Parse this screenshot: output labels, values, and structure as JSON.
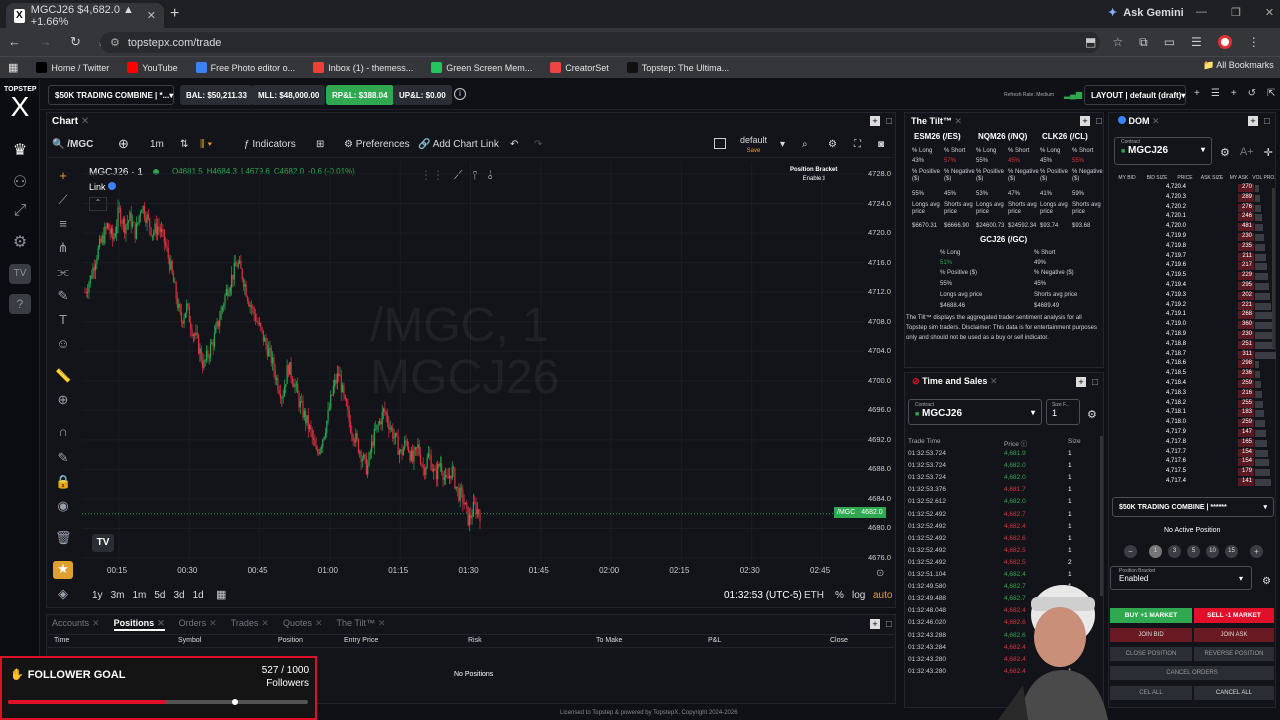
{
  "browser": {
    "tab_title": "MGCJ26 $4,682.0 ▲ +1.66%",
    "tab_favicon": "X",
    "url": "topstepx.com/trade",
    "ask_gemini": "Ask Gemini",
    "bookmarks": [
      {
        "label": "Home / Twitter",
        "icon": "x-icon",
        "color": "#000000"
      },
      {
        "label": "YouTube",
        "icon": "youtube-icon",
        "color": "#ff0000"
      },
      {
        "label": "Free Photo editor o...",
        "icon": "photo-icon",
        "color": "#3b82f6"
      },
      {
        "label": "Inbox (1) - themess...",
        "icon": "gmail-icon",
        "color": "#ea4335"
      },
      {
        "label": "Green Screen Mem...",
        "icon": "green-icon",
        "color": "#22c55e"
      },
      {
        "label": "CreatorSet",
        "icon": "creatorset-icon",
        "color": "#ef4444"
      },
      {
        "label": "Topstep: The Ultima...",
        "icon": "topstep-icon",
        "color": "#111111"
      }
    ],
    "all_bookmarks": "All Bookmarks"
  },
  "app": {
    "logo_top": "TOPSTEP",
    "logo_letter": "X",
    "account_select": "$50K TRADING COMBINE | *...",
    "bal": "BAL: $50,211.33",
    "mll": "MLL: $48,000.00",
    "rpl": "RP&L: $388.04",
    "upl": "UP&L: $0.00",
    "refresh_rate": "Refresh Rate: Medium",
    "layout": "LAYOUT | default (draft)"
  },
  "chart": {
    "panel_title": "Chart",
    "symbol_search": "/MGC",
    "interval": "1m",
    "indicators": "Indicators",
    "preferences": "Preferences",
    "add_chart_link": "Add Chart Link",
    "layout_name": "default",
    "layout_save": "Save",
    "symbol_line": "MGCJ26 · 1",
    "ohlc": {
      "o": "O4681.5",
      "h": "H4684.3",
      "l": "L4679.6",
      "c": "C4682.0",
      "chg": "-0.6 (-0.01%)"
    },
    "link_label": "Link",
    "position_bracket": "Position Bracket",
    "position_bracket_state": "Enabled",
    "watermark1": "/MGC, 1",
    "watermark2": "MGCJ26",
    "price_label_symbol": "/MGC",
    "price_label_value": "4682.0",
    "bottom_timeframes": [
      "1y",
      "3m",
      "1m",
      "5d",
      "3d",
      "1d"
    ],
    "clock": "01:32:53 (UTC-5)",
    "session": "ETH",
    "pct": "%",
    "log": "log",
    "auto": "auto"
  },
  "chart_data": {
    "type": "candlestick",
    "xticks": [
      "00:15",
      "00:30",
      "00:45",
      "01:00",
      "01:15",
      "01:30",
      "01:45",
      "02:00",
      "02:15",
      "02:30",
      "02:45"
    ],
    "yticks": [
      "4728.0",
      "4724.0",
      "4720.0",
      "4716.0",
      "4712.0",
      "4708.0",
      "4704.0",
      "4700.0",
      "4696.0",
      "4692.0",
      "4688.0",
      "4684.0",
      "4680.0",
      "4676.0"
    ],
    "ylim": [
      4676,
      4728
    ],
    "close_path": [
      4712,
      4714,
      4717,
      4719,
      4721,
      4719,
      4723,
      4721,
      4722,
      4720,
      4724,
      4722,
      4720,
      4721,
      4719,
      4716,
      4712,
      4708,
      4710,
      4707,
      4705,
      4702,
      4704,
      4706,
      4709,
      4712,
      4714,
      4716,
      4714,
      4711,
      4709,
      4707,
      4705,
      4703,
      4700,
      4698,
      4702,
      4700,
      4697,
      4695,
      4693,
      4690,
      4692,
      4695,
      4699,
      4701,
      4697,
      4694,
      4692,
      4690,
      4688,
      4692,
      4694,
      4696,
      4694,
      4692,
      4690,
      4692,
      4689,
      4691,
      4688,
      4690,
      4687,
      4689,
      4686,
      4688,
      4685,
      4684,
      4681,
      4683,
      4682
    ]
  },
  "tilt": {
    "title": "The Tilt™",
    "instruments": [
      {
        "name": "ESM26 (/ES)",
        "long_pct": "43%",
        "short_pct": "57%",
        "pos": "55%",
        "neg": "45%",
        "long_avg": "$6670.31",
        "short_avg": "$6666.90"
      },
      {
        "name": "NQM26 (/NQ)",
        "long_pct": "55%",
        "short_pct": "45%",
        "pos": "53%",
        "neg": "47%",
        "long_avg": "$24600.73",
        "short_avg": "$24592.34"
      },
      {
        "name": "CLK26 (/CL)",
        "long_pct": "45%",
        "short_pct": "55%",
        "pos": "41%",
        "neg": "59%",
        "long_avg": "$93.74",
        "short_avg": "$93.68"
      }
    ],
    "gc": {
      "name": "GCJ26 (/GC)",
      "long_pct": "51%",
      "short_pct": "49%",
      "pos": "55%",
      "neg": "45%",
      "long_avg": "$4688.46",
      "short_avg": "$4689.49"
    },
    "labels": {
      "long": "% Long",
      "short": "% Short",
      "pos": "% Positive ($)",
      "neg": "% Negative ($)",
      "long_avg": "Longs avg price",
      "short_avg": "Shorts avg price"
    },
    "disclaimer": "The Tilt™ displays the aggregated trader sentiment analysis for all Topstep sim traders. Disclaimer: This data is for entertainment purposes only and should not be used as a buy or sell indicator."
  },
  "tns": {
    "title": "Time and Sales",
    "contract_label": "Contract",
    "contract": "MGCJ26",
    "size_label": "Size F...",
    "size": "1",
    "headers": [
      "Trade Time",
      "Price",
      "Size"
    ],
    "rows": [
      [
        "01:32:53.724",
        "4,681.9",
        "1",
        "g"
      ],
      [
        "01:32:53.724",
        "4,682.0",
        "1",
        "g"
      ],
      [
        "01:32:53.724",
        "4,682.0",
        "1",
        "g"
      ],
      [
        "01:32:53.376",
        "4,681.7",
        "1",
        "r"
      ],
      [
        "01:32:52.612",
        "4,682.0",
        "1",
        "g"
      ],
      [
        "01:32:52.492",
        "4,682.7",
        "1",
        "r"
      ],
      [
        "01:32:52.492",
        "4,682.4",
        "1",
        "r"
      ],
      [
        "01:32:52.492",
        "4,682.6",
        "1",
        "r"
      ],
      [
        "01:32:52.492",
        "4,682.5",
        "1",
        "r"
      ],
      [
        "01:32:52.492",
        "4,682.5",
        "2",
        "r"
      ],
      [
        "01:32:51.104",
        "4,682.4",
        "1",
        "g"
      ],
      [
        "01:32:49.580",
        "4,682.7",
        "1",
        "g"
      ],
      [
        "01:32:49.488",
        "4,682.7",
        "1",
        "g"
      ],
      [
        "01:32:48.048",
        "4,682.4",
        "1",
        "r"
      ],
      [
        "01:32:46.020",
        "4,682.6",
        "1",
        "r"
      ],
      [
        "01:32:43.288",
        "4,682.6",
        "1",
        "g"
      ],
      [
        "01:32:43.284",
        "4,682.4",
        "1",
        "r"
      ],
      [
        "01:32:43.280",
        "4,682.4",
        "1",
        "r"
      ],
      [
        "01:32:43.280",
        "4,682.4",
        "1",
        "r"
      ]
    ]
  },
  "dom": {
    "title": "DOM",
    "contract_label": "Contract",
    "contract": "MGCJ26",
    "headers": [
      "MY BID",
      "BID SIZE",
      "PRICE",
      "ASK SIZE",
      "MY ASK",
      "VOL PRO."
    ],
    "rows": [
      [
        "4,720.4",
        "270"
      ],
      [
        "4,720.3",
        "289"
      ],
      [
        "4,720.2",
        "276"
      ],
      [
        "4,720.1",
        "246"
      ],
      [
        "4,720.0",
        "481"
      ],
      [
        "4,719.9",
        "230"
      ],
      [
        "4,719.8",
        "235"
      ],
      [
        "4,719.7",
        "211"
      ],
      [
        "4,719.6",
        "217"
      ],
      [
        "4,719.5",
        "229"
      ],
      [
        "4,719.4",
        "295"
      ],
      [
        "4,719.3",
        "202"
      ],
      [
        "4,719.2",
        "221"
      ],
      [
        "4,719.1",
        "268"
      ],
      [
        "4,719.0",
        "360"
      ],
      [
        "4,718.9",
        "230"
      ],
      [
        "4,718.8",
        "251"
      ],
      [
        "4,718.7",
        "311"
      ],
      [
        "4,718.6",
        "298"
      ],
      [
        "4,718.5",
        "236"
      ],
      [
        "4,718.4",
        "259"
      ],
      [
        "4,718.3",
        "216"
      ],
      [
        "4,718.2",
        "255"
      ],
      [
        "4,718.1",
        "183"
      ],
      [
        "4,718.0",
        "259"
      ],
      [
        "4,717.9",
        "147"
      ],
      [
        "4,717.8",
        "165"
      ],
      [
        "4,717.7",
        "154"
      ],
      [
        "4,717.6",
        "154"
      ],
      [
        "4,717.5",
        "179"
      ],
      [
        "4,717.4",
        "141"
      ]
    ],
    "account": "$50K TRADING COMBINE | ******",
    "no_position": "No Active Position",
    "qty": [
      "1",
      "3",
      "5",
      "10",
      "15"
    ],
    "bracket_label": "Position Bracket",
    "bracket_value": "Enabled",
    "buy": "BUY +1 MARKET",
    "sell": "SELL -1 MARKET",
    "join_bid": "JOIN BID",
    "join_ask": "JOIN ASK",
    "close_position": "CLOSE POSITION",
    "reverse_position": "REVERSE POSITION",
    "cancel_orders": "CANCEL ORDERS",
    "cancel_all": "CANCEL ALL",
    "cancel_all_short": "CEL ALL"
  },
  "bottom": {
    "tabs": [
      "Accounts",
      "Positions",
      "Orders",
      "Trades",
      "Quotes",
      "The Tilt™"
    ],
    "columns": [
      "Time",
      "Symbol",
      "Position",
      "Entry Price",
      "Risk",
      "To Make",
      "P&L",
      "Close"
    ],
    "empty": "No Positions"
  },
  "follower": {
    "label": "FOLLOWER GOAL",
    "count": "527 / 1000",
    "unit": "Followers",
    "progress": 0.527
  },
  "footer": "Licensed to Topstep & powered by TopstepX. Copyright 2024-2026"
}
